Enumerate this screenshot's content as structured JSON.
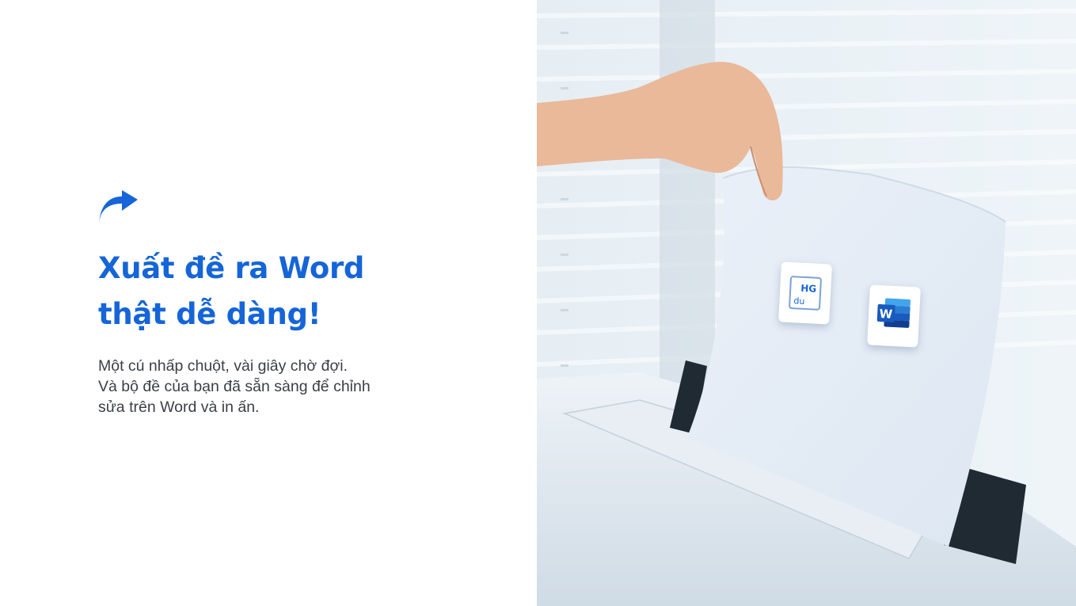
{
  "headline": {
    "line1": "Xuất đề ra Word",
    "line2": "thật dễ dàng!"
  },
  "description": {
    "line1": "Một cú nhấp chuột, vài giây chờ đợi.",
    "line2": "Và bộ đề của bạn đã sẵn sàng để chỉnh",
    "line3": "sửa trên Word và in ấn."
  },
  "icons": {
    "share": "share-arrow-icon",
    "brand_app": "hg-edu-logo-icon",
    "word_app": "microsoft-word-icon"
  },
  "logos": {
    "hgedu_text_top": "HG",
    "hgedu_text_bottom": "du",
    "word_letter": "W"
  },
  "colors": {
    "accent": "#1565d8",
    "body_text": "#3b3f45",
    "background": "#ffffff"
  }
}
